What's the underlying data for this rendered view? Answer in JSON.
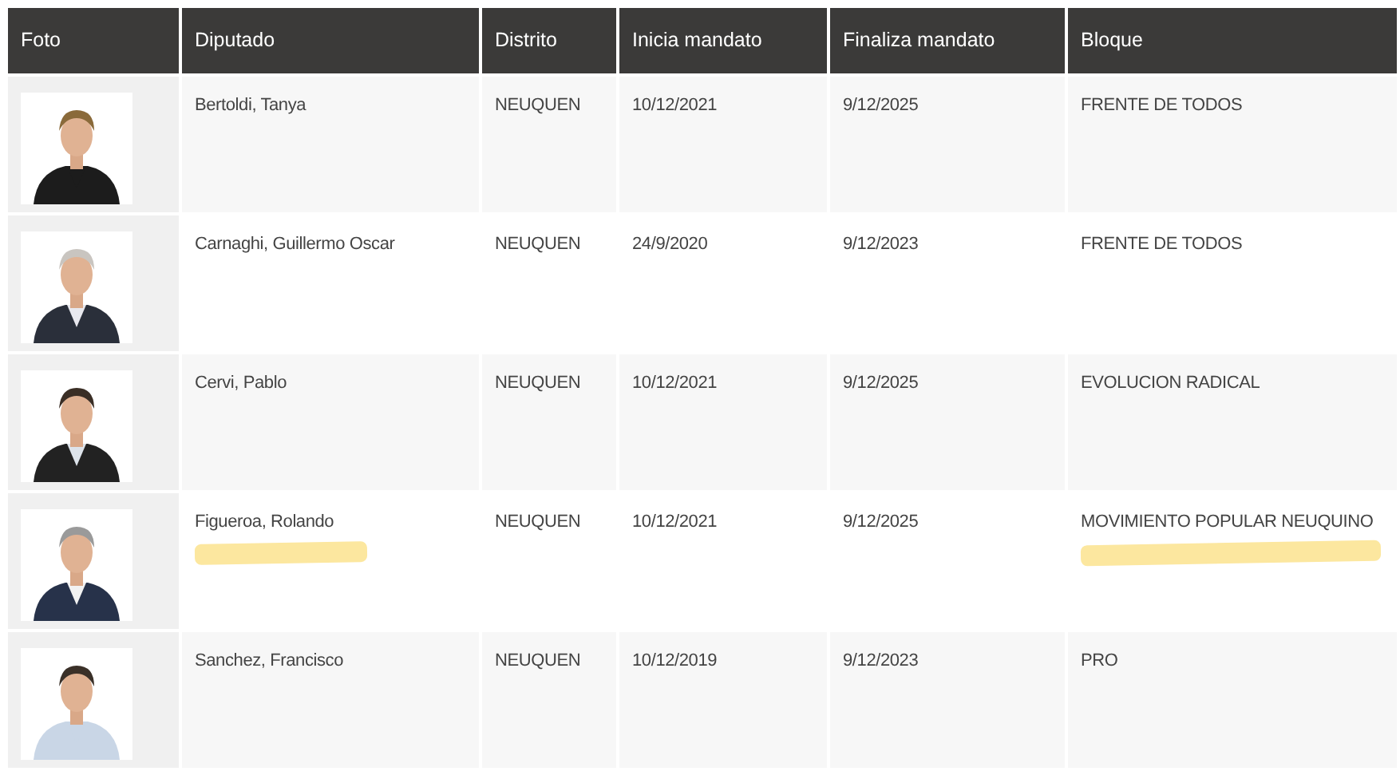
{
  "table": {
    "columns": [
      "Foto",
      "Diputado",
      "Distrito",
      "Inicia mandato",
      "Finaliza mandato",
      "Bloque"
    ],
    "rows": [
      {
        "diputado": "Bertoldi, Tanya",
        "distrito": "NEUQUEN",
        "inicia": "10/12/2021",
        "finaliza": "9/12/2025",
        "bloque": "FRENTE DE TODOS",
        "highlighted": false
      },
      {
        "diputado": "Carnaghi, Guillermo Oscar",
        "distrito": "NEUQUEN",
        "inicia": "24/9/2020",
        "finaliza": "9/12/2023",
        "bloque": "FRENTE DE TODOS",
        "highlighted": false
      },
      {
        "diputado": "Cervi, Pablo",
        "distrito": "NEUQUEN",
        "inicia": "10/12/2021",
        "finaliza": "9/12/2025",
        "bloque": "EVOLUCION RADICAL",
        "highlighted": false
      },
      {
        "diputado": "Figueroa, Rolando",
        "distrito": "NEUQUEN",
        "inicia": "10/12/2021",
        "finaliza": "9/12/2025",
        "bloque": "MOVIMIENTO POPULAR NEUQUINO",
        "highlighted": true
      },
      {
        "diputado": "Sanchez, Francisco",
        "distrito": "NEUQUEN",
        "inicia": "10/12/2019",
        "finaliza": "9/12/2023",
        "bloque": "PRO",
        "highlighted": false
      }
    ]
  }
}
